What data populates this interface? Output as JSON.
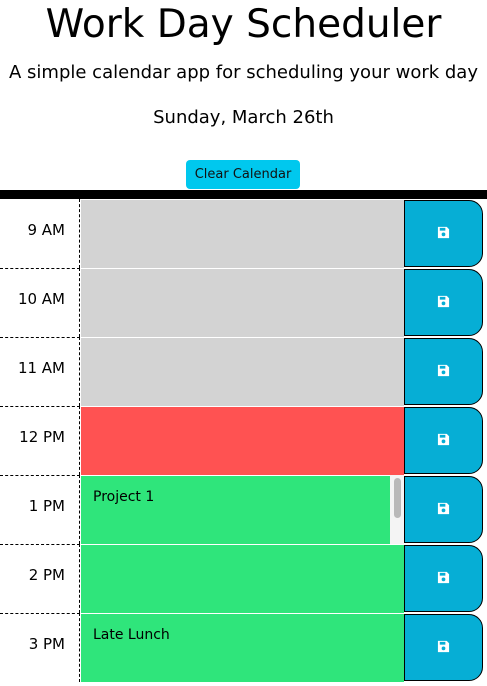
{
  "header": {
    "title": "Work Day Scheduler",
    "subtitle": "A simple calendar app for scheduling your work day",
    "current_day": "Sunday, March 26th",
    "clear_label": "Clear Calendar"
  },
  "colors": {
    "past": "#d3d3d3",
    "present": "#ff5252",
    "future": "#2fe57b",
    "save_button": "#06aed5",
    "clear_button": "#00c8ee"
  },
  "timeblocks": [
    {
      "hour": "9 AM",
      "text": "",
      "status": "past",
      "icon": "save-icon"
    },
    {
      "hour": "10 AM",
      "text": "",
      "status": "past",
      "icon": "save-icon"
    },
    {
      "hour": "11 AM",
      "text": "",
      "status": "past",
      "icon": "save-icon"
    },
    {
      "hour": "12 PM",
      "text": "",
      "status": "present",
      "icon": "save-icon"
    },
    {
      "hour": "1 PM",
      "text": "Project 1",
      "status": "future",
      "icon": "save-icon"
    },
    {
      "hour": "2 PM",
      "text": "",
      "status": "future",
      "icon": "save-icon"
    },
    {
      "hour": "3 PM",
      "text": "Late Lunch",
      "status": "future",
      "icon": "save-icon"
    }
  ]
}
